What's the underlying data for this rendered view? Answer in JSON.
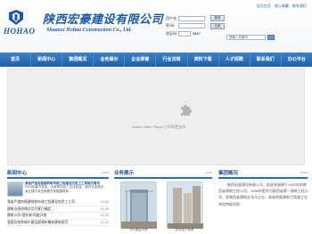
{
  "header": {
    "logo_en": "HOHAO",
    "company_cn": "陕西宏豪建设有限公司",
    "company_en": "Shaanxi Hohao Construction Co., Ltd.",
    "top_links": [
      "设为主页",
      "加入收藏",
      "联系我们"
    ]
  },
  "login": {
    "username_label": "用户名:",
    "password_label": "密 码:",
    "code_label": "验证码:",
    "code_value": "3817",
    "login_button": "登录",
    "register_button": "注册"
  },
  "search": {
    "placeholder": "请输入关键字"
  },
  "nav": {
    "items": [
      "首页",
      "新闻中心",
      "集团概况",
      "业务展示",
      "企业荣誉",
      "行业法规",
      "资料下载",
      "人才招聘",
      "联系我们",
      "办公平台"
    ]
  },
  "flash": {
    "message": "Adobe Flash Player 已不再受支持"
  },
  "news": {
    "title": "新闻中心",
    "more": "more",
    "lead_title": "我省严查房屋建筑和市政工程建设农民工工资拖欠情况",
    "lead_text": "2015年春节将至，为保障农民工合法权益，维护社会稳定，省住建厅将全面展开房屋建筑和...",
    "rows": [
      {
        "title": "我省严查房屋建筑和市政工程建设农民工工资...",
        "date": "12-09"
      },
      {
        "title": "建筑业营改增试点方案已确定...",
        "date": "12-09"
      },
      {
        "title": "建筑公司“国外施”再度开放",
        "date": "12-09"
      },
      {
        "title": "我国住房和城乡建设部颁布最新建筑规范",
        "date": "12-09"
      }
    ]
  },
  "showcase": {
    "title": "业务展示",
    "more": "more",
    "photos": [
      {
        "caption": "汉中银监大厦"
      },
      {
        "caption": "西安国人商厦"
      }
    ]
  },
  "about": {
    "title": "集团概况",
    "more": "more",
    "text": "陕西宏豪建设有限公司，前身系始建于1953年的陕西省建筑工程公司，1958年更名为陕西省第一建筑工程公司，是陕西省建筑业龙头企业，具有房屋建筑工程施工总承包特级资质..."
  }
}
